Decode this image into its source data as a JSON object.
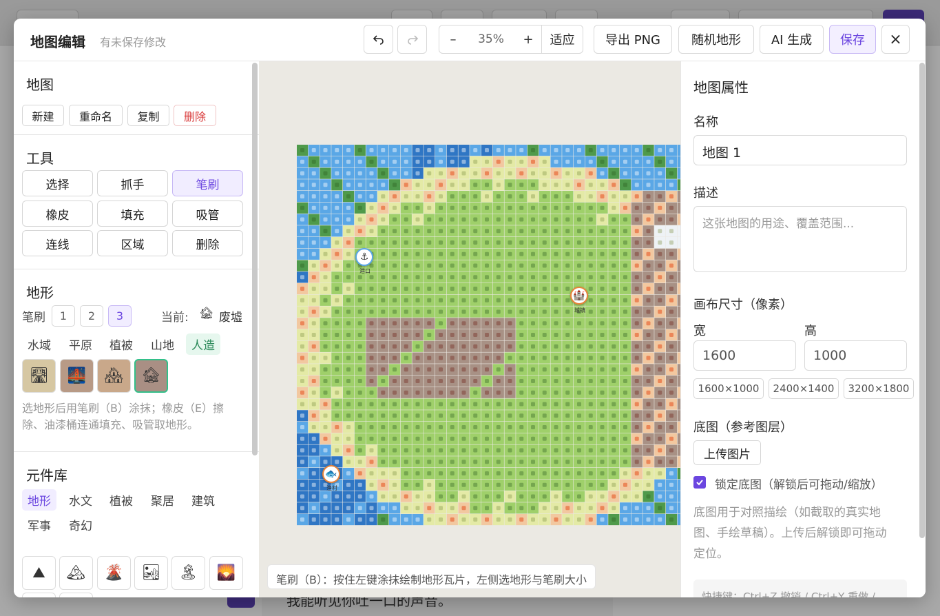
{
  "background": {
    "bottom_text": "我能听见你吐一口的声音。"
  },
  "header": {
    "title": "地图编辑",
    "subtitle": "有未保存修改",
    "undo_icon": "undo-icon",
    "redo_icon": "redo-icon",
    "zoom_out": "–",
    "zoom_value": "35%",
    "zoom_in": "+",
    "fit_label": "适应",
    "export_label": "导出 PNG",
    "random_label": "随机地形",
    "ai_label": "AI 生成",
    "save_label": "保存",
    "close_label": "×"
  },
  "left": {
    "map_section": {
      "title": "地图",
      "buttons": [
        "新建",
        "重命名",
        "复制",
        "删除"
      ]
    },
    "tools_section": {
      "title": "工具",
      "tools": [
        "选择",
        "抓手",
        "笔刷",
        "橡皮",
        "填充",
        "吸管",
        "连线",
        "区域",
        "删除"
      ],
      "active": "笔刷"
    },
    "terrain_section": {
      "title": "地形",
      "brush_label": "笔刷",
      "brush_sizes": [
        "1",
        "2",
        "3"
      ],
      "active_size": "3",
      "current_label": "当前:",
      "current_icon": "ruin-house-icon",
      "current_value": "废墟",
      "tabs": [
        "水域",
        "平原",
        "植被",
        "山地",
        "人造"
      ],
      "active_tab": "人造",
      "tiles": [
        "road-icon",
        "bridge-icon",
        "village-icon",
        "ruin-icon"
      ],
      "help_text": "选地形后用笔刷（B）涂抹；橡皮（E）擦除、油漆桶连通填充、吸管取地形。"
    },
    "library_section": {
      "title": "元件库",
      "tabs": [
        "地形",
        "水文",
        "植被",
        "聚居",
        "建筑",
        "军事",
        "奇幻"
      ],
      "active_tab": "地形",
      "tiles": [
        "mountain-icon",
        "snow-mountain-icon",
        "volcano-icon",
        "desert-icon",
        "palm-island-icon",
        "sunset-hills-icon",
        "lake-mountain-icon",
        "snowflake-icon"
      ]
    }
  },
  "canvas": {
    "hint": "笔刷（B）：按住左键涂抹绘制地形瓦片，左侧选地形与笔刷大小",
    "markers": [
      {
        "icon": "anchor-icon",
        "label": "港口"
      },
      {
        "icon": "castle-icon",
        "label": "城镇"
      },
      {
        "icon": "fish-icon",
        "label": "渔村"
      }
    ]
  },
  "right": {
    "title": "地图属性",
    "name_label": "名称",
    "name_value": "地图 1",
    "desc_label": "描述",
    "desc_placeholder": "这张地图的用途、覆盖范围...",
    "canvas_size_label": "画布尺寸（像素）",
    "width_label": "宽",
    "height_label": "高",
    "width_value": "1600",
    "height_value": "1000",
    "presets": [
      "1600×1000",
      "2400×1400",
      "3200×1800"
    ],
    "base_label": "底图（参考图层）",
    "upload_label": "上传图片",
    "lock_label": "锁定底图（解锁后可拖动/缩放）",
    "lock_checked": true,
    "base_help": "底图用于对照描绘（如截取的真实地图、手绘草稿）。上传后解锁即可拖动定位。",
    "shortcuts": "快捷键：Ctrl+Z 撤销 / Ctrl+Y 重做 /"
  },
  "colors": {
    "accent": "#6b46e0",
    "accent_bg": "#f1edff",
    "danger": "#d93a3a",
    "water_deep": "#2f76c4",
    "water": "#5aa7e6",
    "grass": "#9fd06a",
    "forest": "#4f9a4b",
    "sand": "#e4eaa6",
    "ruins": "#a89185",
    "hills": "#f2c8a0",
    "snow": "#eef2f5"
  }
}
